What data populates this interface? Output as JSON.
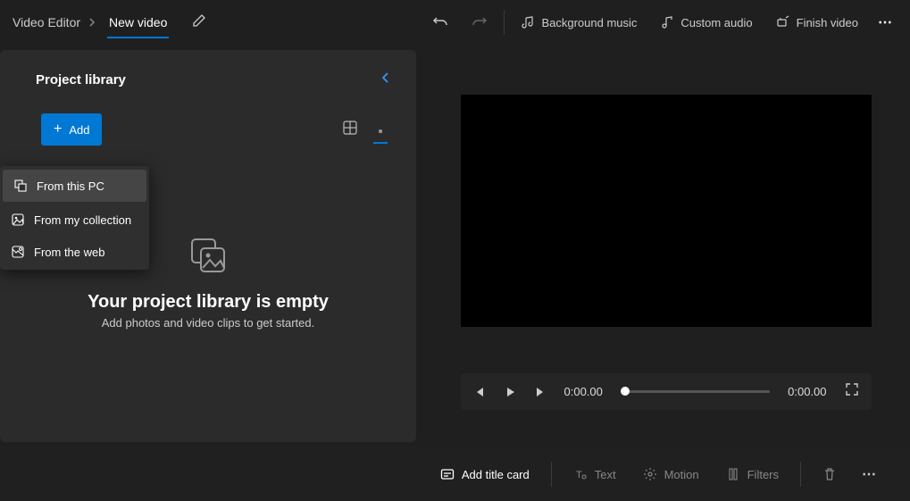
{
  "breadcrumb": {
    "root": "Video Editor",
    "current": "New video"
  },
  "topbar": {
    "bg_music": "Background music",
    "custom_audio": "Custom audio",
    "finish": "Finish video"
  },
  "library": {
    "title": "Project library",
    "add_label": "Add",
    "empty_title": "Your project library is empty",
    "empty_sub": "Add photos and video clips to get started."
  },
  "add_menu": {
    "from_pc": "From this PC",
    "from_collection": "From my collection",
    "from_web": "From the web"
  },
  "player": {
    "current": "0:00.00",
    "total": "0:00.00"
  },
  "bottombar": {
    "add_title_card": "Add title card",
    "text": "Text",
    "motion": "Motion",
    "filters": "Filters"
  }
}
